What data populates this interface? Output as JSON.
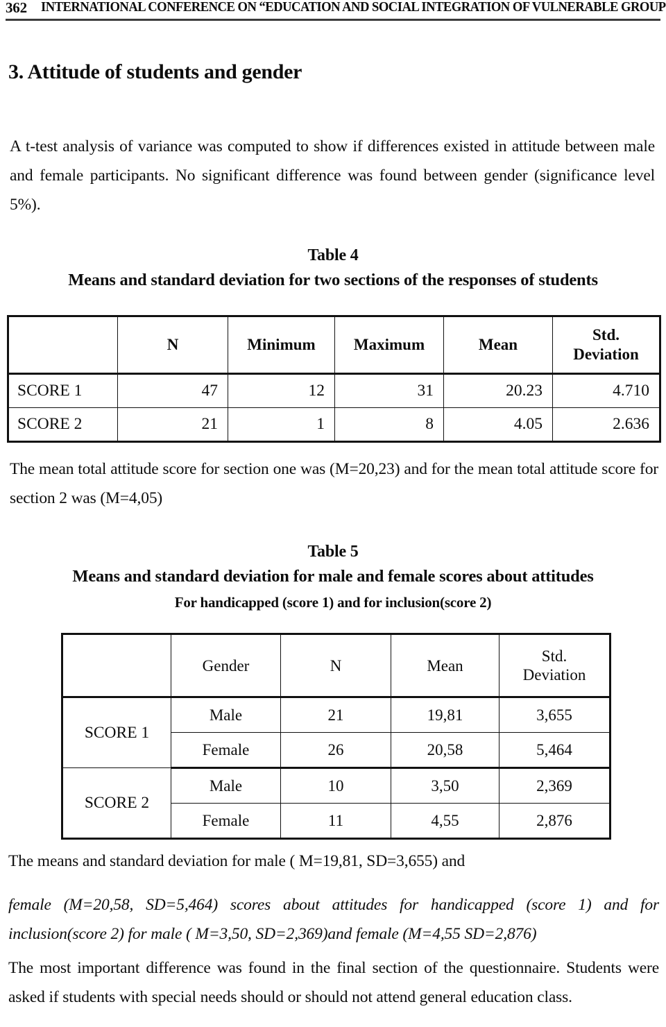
{
  "running_head": {
    "page_number": "362",
    "title": "INTERNATIONAL CONFERENCE ON “EDUCATION AND SOCIAL INTEGRATION OF VULNERABLE GROUPS”"
  },
  "section": {
    "heading": "3. Attitude of students and gender",
    "intro_paragraph": "A t-test analysis of variance was computed to show if differences existed in attitude between male and female participants. No significant difference was found between gender (significance level 5%)."
  },
  "table4": {
    "caption_line1": "Table 4",
    "caption_line2": "Means and standard deviation for two sections of the responses of students",
    "headers": [
      "",
      "N",
      "Minimum",
      "Maximum",
      "Mean",
      "Std. Deviation"
    ],
    "header_std_line1": "Std.",
    "header_std_line2": "Deviation",
    "rows": [
      {
        "label": "SCORE 1",
        "n": "47",
        "minimum": "12",
        "maximum": "31",
        "mean": "20.23",
        "std_deviation": "4.710"
      },
      {
        "label": "SCORE 2",
        "n": "21",
        "minimum": "1",
        "maximum": "8",
        "mean": "4.05",
        "std_deviation": "2.636"
      }
    ],
    "note": "The mean total attitude score for section one was (M=20,23) and for the mean total attitude score for section 2 was (M=4,05)"
  },
  "table5": {
    "caption_line1": "Table 5",
    "caption_line2": "Means and standard deviation for male and female scores about attitudes",
    "caption_line3": "For handicapped (score 1) and for inclusion(score 2)",
    "headers": [
      "",
      "Gender",
      "N",
      "Mean",
      "Std. Deviation"
    ],
    "header_std_line1": "Std.",
    "header_std_line2": "Deviation",
    "groups": [
      {
        "label": "SCORE 1",
        "rows": [
          {
            "gender": "Male",
            "n": "21",
            "mean": "19,81",
            "std_deviation": "3,655"
          },
          {
            "gender": "Female",
            "n": "26",
            "mean": "20,58",
            "std_deviation": "5,464"
          }
        ]
      },
      {
        "label": "SCORE 2",
        "rows": [
          {
            "gender": "Male",
            "n": "10",
            "mean": "3,50",
            "std_deviation": "2,369"
          },
          {
            "gender": "Female",
            "n": "11",
            "mean": "4,55",
            "std_deviation": "2,876"
          }
        ]
      }
    ],
    "note_line1": "The means and standard deviation for male ( M=19,81, SD=3,655) and",
    "note_line2": "female (M=20,58, SD=5,464) scores about attitudes for handicapped (score 1) and for inclusion(score 2) for male ( M=3,50, SD=2,369)and female (M=4,55 SD=2,876)"
  },
  "closing": {
    "final_paragraph": "The most important difference was found in the final section of the questionnaire. Students were asked if students with special needs should or should not attend general education class."
  }
}
